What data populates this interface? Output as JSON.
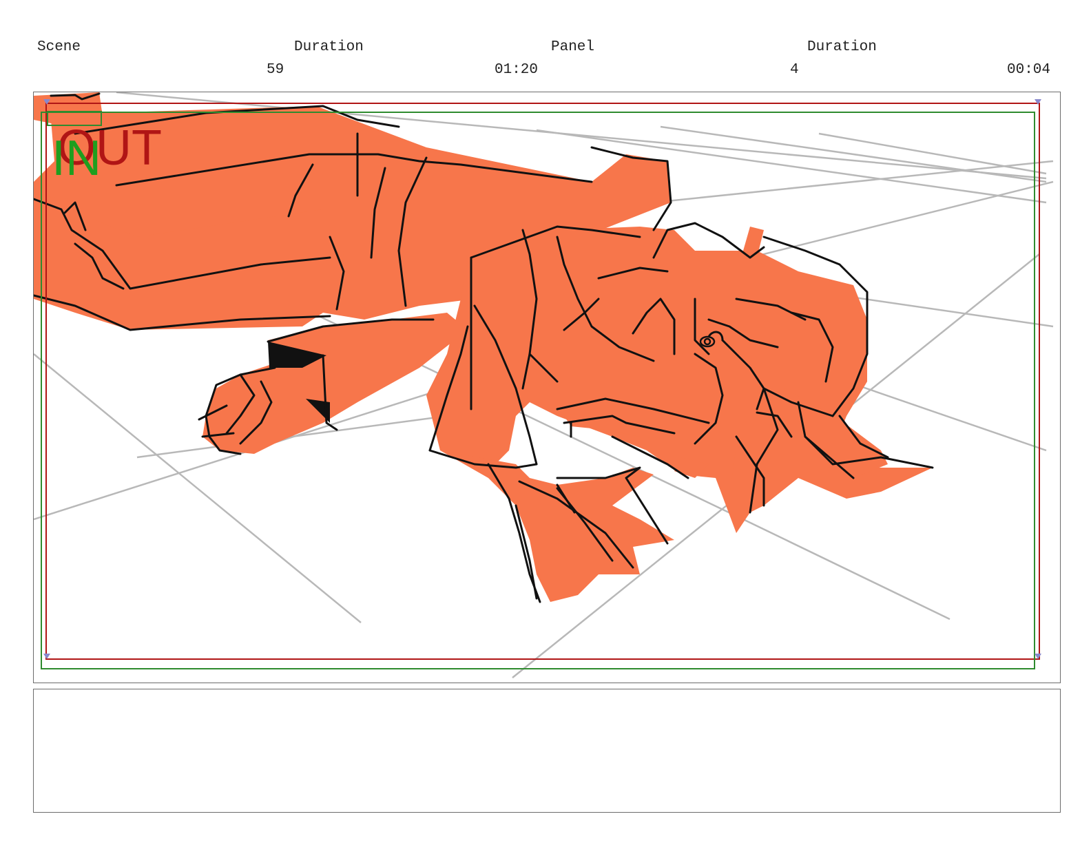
{
  "header": {
    "scene_label": "Scene",
    "scene_value": "59",
    "scene_duration_label": "Duration",
    "scene_duration_value": "01:20",
    "panel_label": "Panel",
    "panel_value": "4",
    "panel_duration_label": "Duration",
    "panel_duration_value": "00:04"
  },
  "frame": {
    "in_marker": "IN",
    "out_marker": "OUT",
    "in_color": "#1f9e1f",
    "out_color": "#b01515",
    "fill_color": "#f7764b",
    "line_color": "#111111",
    "guide_color": "#b8b8b8"
  },
  "notes": {
    "text": ""
  }
}
